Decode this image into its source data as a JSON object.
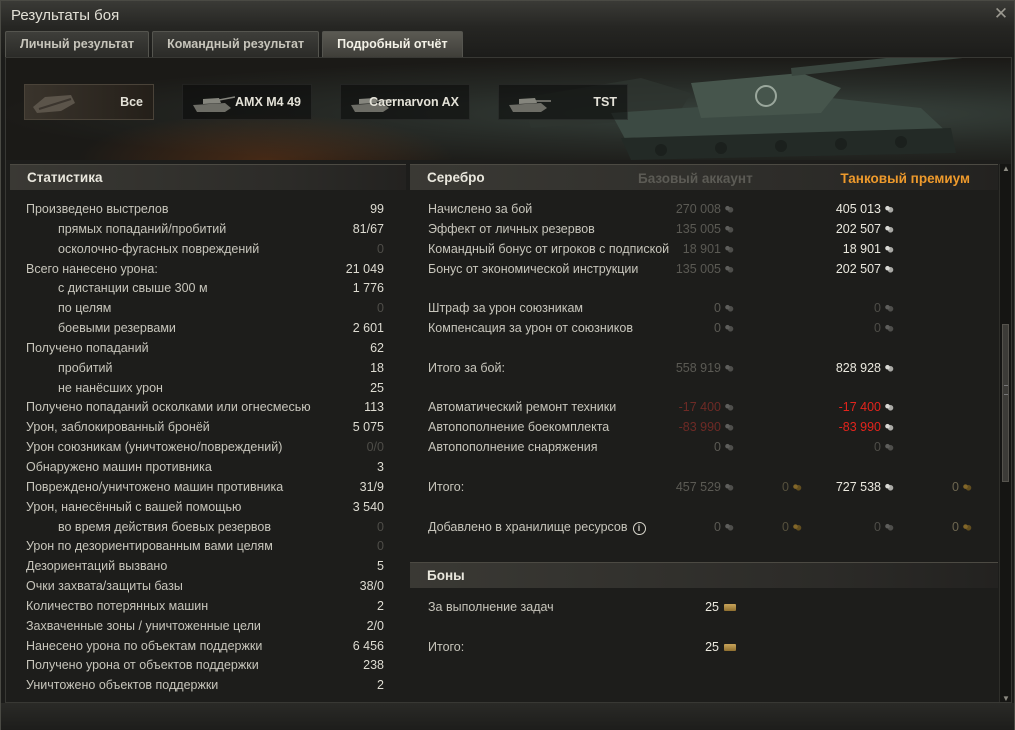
{
  "window": {
    "title": "Результаты боя"
  },
  "tabs": [
    {
      "label": "Личный результат"
    },
    {
      "label": "Командный результат"
    },
    {
      "label": "Подробный отчёт"
    }
  ],
  "vehicles": [
    {
      "label": "Все"
    },
    {
      "label": "AMX M4 49"
    },
    {
      "label": "Caernarvon AX"
    },
    {
      "label": "TST"
    }
  ],
  "statistics": {
    "title": "Статистика",
    "rows": [
      {
        "label": "Произведено выстрелов",
        "value": "99",
        "indent": false,
        "dim": false
      },
      {
        "label": "прямых попаданий/пробитий",
        "value": "81/67",
        "indent": true,
        "dim": false
      },
      {
        "label": "осколочно-фугасных повреждений",
        "value": "0",
        "indent": true,
        "dim": true
      },
      {
        "label": "Всего нанесено урона:",
        "value": "21 049",
        "indent": false,
        "dim": false
      },
      {
        "label": "с дистанции свыше 300 м",
        "value": "1 776",
        "indent": true,
        "dim": false
      },
      {
        "label": "по целям",
        "value": "0",
        "indent": true,
        "dim": true
      },
      {
        "label": "боевыми резервами",
        "value": "2 601",
        "indent": true,
        "dim": false
      },
      {
        "label": "Получено попаданий",
        "value": "62",
        "indent": false,
        "dim": false
      },
      {
        "label": "пробитий",
        "value": "18",
        "indent": true,
        "dim": false
      },
      {
        "label": "не нанёсших урон",
        "value": "25",
        "indent": true,
        "dim": false
      },
      {
        "label": "Получено попаданий осколками или огнесмесью",
        "value": "113",
        "indent": false,
        "dim": false
      },
      {
        "label": "Урон, заблокированный бронёй",
        "value": "5 075",
        "indent": false,
        "dim": false
      },
      {
        "label": "Урон союзникам (уничтожено/повреждений)",
        "value": "0/0",
        "indent": false,
        "dim": true
      },
      {
        "label": "Обнаружено машин противника",
        "value": "3",
        "indent": false,
        "dim": false
      },
      {
        "label": "Повреждено/уничтожено машин противника",
        "value": "31/9",
        "indent": false,
        "dim": false
      },
      {
        "label": "Урон, нанесённый с вашей помощью",
        "value": "3 540",
        "indent": false,
        "dim": false
      },
      {
        "label": "во время действия боевых резервов",
        "value": "0",
        "indent": true,
        "dim": true
      },
      {
        "label": "Урон по дезориентированным вами целям",
        "value": "0",
        "indent": false,
        "dim": true
      },
      {
        "label": "Дезориентаций вызвано",
        "value": "5",
        "indent": false,
        "dim": false
      },
      {
        "label": "Очки захвата/защиты базы",
        "value": "38/0",
        "indent": false,
        "dim": false
      },
      {
        "label": "Количество потерянных машин",
        "value": "2",
        "indent": false,
        "dim": false
      },
      {
        "label": "Захваченные зоны / уничтоженные цели",
        "value": "2/0",
        "indent": false,
        "dim": false
      },
      {
        "label": "Нанесено урона по объектам поддержки",
        "value": "6 456",
        "indent": false,
        "dim": false
      },
      {
        "label": "Получено урона от объектов поддержки",
        "value": "238",
        "indent": false,
        "dim": false
      },
      {
        "label": "Уничтожено объектов поддержки",
        "value": "2",
        "indent": false,
        "dim": false
      }
    ]
  },
  "credits": {
    "title": "Серебро",
    "base_header": "Базовый аккаунт",
    "premium_header": "Танковый премиум",
    "rows": [
      {
        "label": "Начислено за бой",
        "base": "270 008",
        "premium": "405 013"
      },
      {
        "label": "Эффект от личных резервов",
        "base": "135 005",
        "premium": "202 507"
      },
      {
        "label": "Командный бонус от игроков с подпиской",
        "base": "18 901",
        "premium": "18 901"
      },
      {
        "label": "Бонус от экономической инструкции",
        "base": "135 005",
        "premium": "202 507"
      },
      {
        "gap": true
      },
      {
        "label": "Штраф за урон союзникам",
        "base": "0",
        "premium": "0",
        "premium_dim": true
      },
      {
        "label": "Компенсация за урон от союзников",
        "base": "0",
        "premium": "0",
        "premium_dim": true
      },
      {
        "gap": true
      },
      {
        "label": "Итого за бой:",
        "base": "558 919",
        "premium": "828 928"
      },
      {
        "gap": true
      },
      {
        "label": "Автоматический ремонт техники",
        "base": "-17 400",
        "premium": "-17 400",
        "red": true
      },
      {
        "label": "Автопополнение боекомплекта",
        "base": "-83 990",
        "premium": "-83 990",
        "red": true
      },
      {
        "label": "Автопополнение снаряжения",
        "base": "0",
        "premium": "0",
        "premium_dim": true
      },
      {
        "gap": true
      },
      {
        "label": "Итого:",
        "base": "457 529",
        "base_gold": "0",
        "premium": "727 538",
        "premium_gold": "0"
      },
      {
        "gap": true
      },
      {
        "label": "Добавлено в хранилище ресурсов",
        "info": true,
        "base": "0",
        "base_gold": "0",
        "premium": "0",
        "premium_gold": "0",
        "premium_dim": true
      }
    ]
  },
  "bonds": {
    "title": "Боны",
    "rows": [
      {
        "label": "За выполнение задач",
        "value": "25"
      },
      {
        "label": "Итого:",
        "value": "25"
      }
    ]
  },
  "colors": {
    "accent": "#ee9a2c",
    "negative": "#e3241c",
    "dimmed": "#4e4d48"
  },
  "icons": {
    "close": "close-icon",
    "credit": "silver-icon",
    "gold": "gold-icon",
    "bond": "bond-icon",
    "info": "info-icon"
  }
}
